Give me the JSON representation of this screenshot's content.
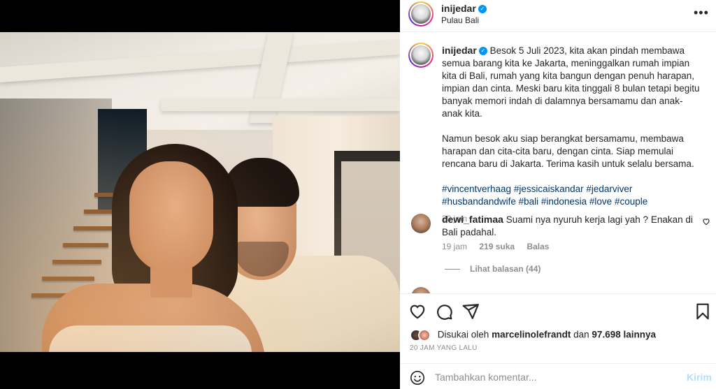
{
  "post": {
    "username": "inijedar",
    "location": "Pulau Bali"
  },
  "caption": {
    "username": "inijedar",
    "paragraph1": "Besok 5 Juli 2023, kita akan pindah membawa semua barang kita ke Jakarta, meninggalkan rumah impian kita di Bali, rumah yang kita bangun dengan penuh harapan, impian dan cinta. Meski baru kita tinggali 8 bulan tetapi begitu banyak memori indah di dalamnya bersamamu dan anak-anak kita.",
    "paragraph2": "Namun besok aku siap berangkat bersamamu, membawa harapan dan cita-cita baru, dengan cinta. Siap memulai rencana baru di Jakarta. Terima kasih untuk selalu bersama.",
    "hashtags": "#vincentverhaag #jessicaiskandar #jedarviver #husbandandwife #bali #indonesia #love #couple",
    "time": "20 jam"
  },
  "comment": {
    "username": "dewi_fatimaa",
    "text": "Suami nya nyuruh kerja lagi yah ? Enakan di Bali padahal.",
    "time": "19 jam",
    "likes": "219 suka",
    "reply": "Balas",
    "view_replies": "Lihat balasan (44)"
  },
  "likes": {
    "prefix": "Disukai oleh",
    "user": "marcelinolefrandt",
    "and": "dan",
    "others": "97.698 lainnya"
  },
  "post_time": "20 JAM YANG LALU",
  "add_comment": {
    "placeholder": "Tambahkan komentar...",
    "post_label": "Kirim"
  },
  "icons": {
    "verified": "verified-badge-icon",
    "more": "more-options-icon",
    "like": "heart-icon",
    "comment": "comment-icon",
    "share": "share-icon",
    "save": "bookmark-icon",
    "emoji": "emoji-icon"
  },
  "colors": {
    "link": "#00376b",
    "verified": "#0095f6",
    "muted": "#8e8e8e",
    "post_button": "#b2dffc"
  }
}
